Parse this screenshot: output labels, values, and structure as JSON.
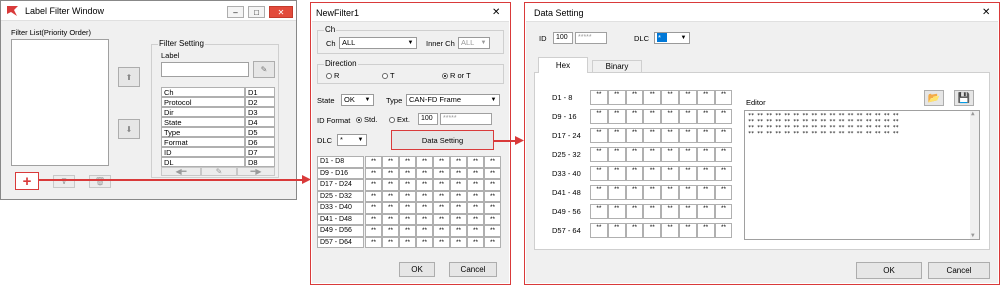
{
  "win1": {
    "title": "Label Filter Window",
    "filter_list_label": "Filter List(Priority Order)",
    "filter_setting": "Filter Setting",
    "label_label": "Label",
    "table": [
      [
        "Ch",
        "D1"
      ],
      [
        "Protocol",
        "D2"
      ],
      [
        "Dir",
        "D3"
      ],
      [
        "State",
        "D4"
      ],
      [
        "Type",
        "D5"
      ],
      [
        "Format",
        "D6"
      ],
      [
        "ID",
        "D7"
      ],
      [
        "DL",
        "D8"
      ]
    ],
    "add": "+"
  },
  "win2": {
    "title": "NewFilter1",
    "ch_group": "Ch",
    "ch_label": "Ch",
    "ch_value": "ALL",
    "inner_ch_label": "Inner Ch",
    "inner_ch_value": "ALL",
    "direction_group": "Direction",
    "dir_r": "R",
    "dir_t": "T",
    "dir_rt": "R or T",
    "state_label": "State",
    "state_value": "OK",
    "type_label": "Type",
    "type_value": "CAN-FD Frame",
    "id_format_label": "ID Format",
    "std": "Std.",
    "ext": "Ext.",
    "id_value": "100",
    "id_mask": "*****",
    "dlc_label": "DLC",
    "dlc_value": "*",
    "data_setting": "Data Setting",
    "rows": [
      "D1 - D8",
      "D9 - D16",
      "D17 - D24",
      "D25 - D32",
      "D33 - D40",
      "D41 - D48",
      "D49 - D56",
      "D57 - D64"
    ],
    "cell": "**",
    "ok": "OK",
    "cancel": "Cancel"
  },
  "win3": {
    "title": "Data Setting",
    "id_label": "ID",
    "id_value": "100",
    "id_mask": "*****",
    "dlc_label": "DLC",
    "dlc_value": "*",
    "tab_hex": "Hex",
    "tab_binary": "Binary",
    "rows": [
      "D1 - 8",
      "D9 - 16",
      "D17 - 24",
      "D25 - 32",
      "D33 - 40",
      "D41 - 48",
      "D49 - 56",
      "D57 - 64"
    ],
    "cell": "**",
    "editor_label": "Editor",
    "editor_lines": [
      "** ** ** ** ** ** ** ** ** ** ** ** ** ** ** ** **",
      "** ** ** ** ** ** ** ** ** ** ** ** ** ** ** ** **",
      "** ** ** ** ** ** ** ** ** ** ** ** ** ** ** ** **",
      "** ** ** ** ** ** ** ** ** ** ** ** ** ** ** ** **"
    ],
    "ok": "OK",
    "cancel": "Cancel"
  },
  "colors": {
    "highlight": "#d93a3a",
    "selection": "#0078d7"
  }
}
